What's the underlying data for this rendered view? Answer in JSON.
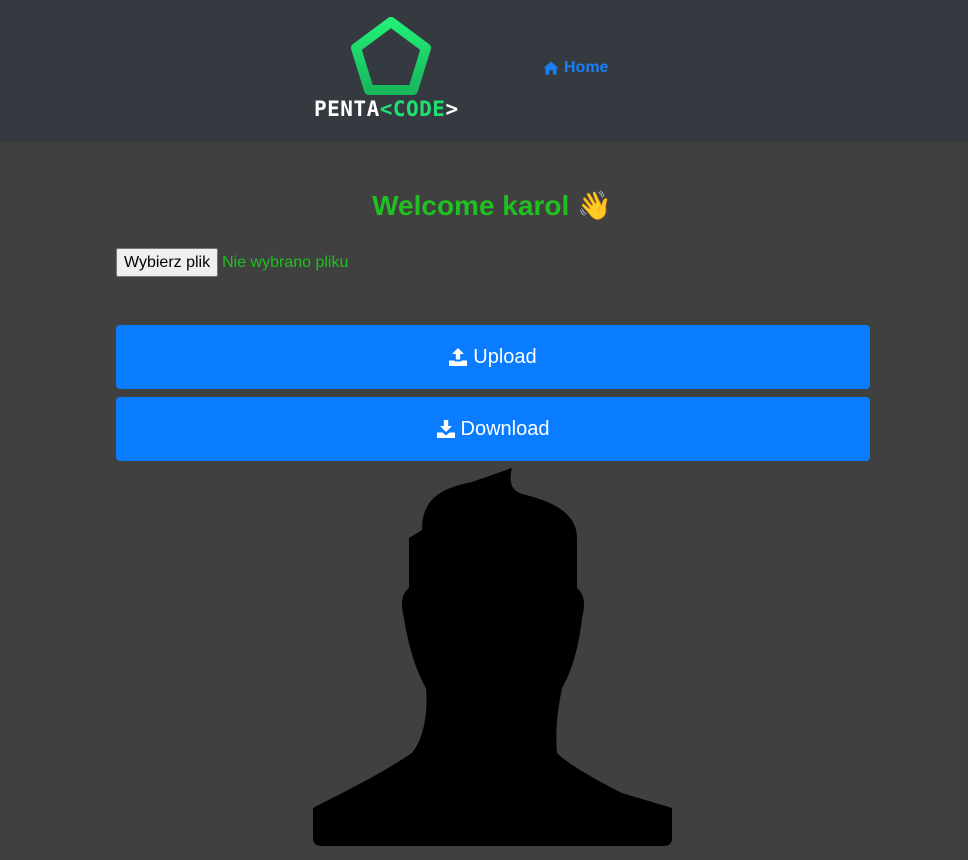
{
  "navbar": {
    "brand": {
      "part1": "PENTA",
      "part2": "<CODE",
      "part3": ">"
    },
    "home_label": "Home"
  },
  "main": {
    "welcome_text": "Welcome karol",
    "welcome_emoji": "👋",
    "file_input": {
      "button_label": "Wybierz plik",
      "status_text": "Nie wybrano pliku"
    },
    "upload_label": "Upload",
    "download_label": "Download"
  },
  "icons": {
    "logo": "pentagon-logo-icon",
    "home": "home-icon",
    "upload": "upload-icon",
    "download": "download-icon",
    "avatar": "avatar-silhouette"
  },
  "colors": {
    "navbar_bg": "#353a40",
    "page_bg": "#404040",
    "accent_blue": "#0a7cff",
    "welcome_green": "#1fc01f",
    "logo_green": "#20e070"
  }
}
